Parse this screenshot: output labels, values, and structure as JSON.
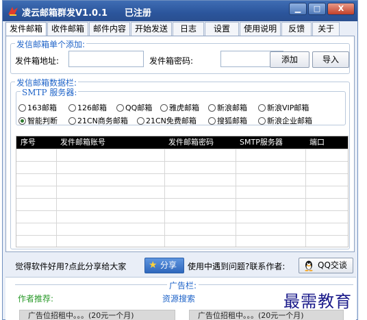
{
  "window": {
    "title": "凌云邮箱群发V1.0.1",
    "status": "已注册",
    "controls": {
      "minimize": "▁",
      "maximize": "□",
      "close": "X"
    }
  },
  "tabs": [
    {
      "label": "发件邮箱",
      "active": true
    },
    {
      "label": "收件邮箱",
      "active": false
    },
    {
      "label": "邮件内容",
      "active": false
    },
    {
      "label": "开始发送",
      "active": false
    },
    {
      "label": "日志",
      "active": false
    },
    {
      "label": "设置",
      "active": false
    },
    {
      "label": "使用说明",
      "active": false
    },
    {
      "label": "反馈",
      "active": false
    },
    {
      "label": "关于",
      "active": false
    }
  ],
  "add_section": {
    "legend": "发信邮箱单个添加:",
    "address_label": "发件箱地址:",
    "address_value": "",
    "password_label": "发件箱密码:",
    "password_value": "",
    "add_button": "添加",
    "import_button": "导入"
  },
  "data_section": {
    "legend": "发信邮箱数据栏:",
    "smtp_legend": "SMTP 服务器:",
    "smtp_options": [
      {
        "label": "163邮箱",
        "selected": false
      },
      {
        "label": "126邮箱",
        "selected": false
      },
      {
        "label": "QQ邮箱",
        "selected": false
      },
      {
        "label": "雅虎邮箱",
        "selected": false
      },
      {
        "label": "新浪邮箱",
        "selected": false
      },
      {
        "label": "新浪VIP邮箱",
        "selected": false
      },
      {
        "label": "智能判断",
        "selected": true
      },
      {
        "label": "21CN商务邮箱",
        "selected": false
      },
      {
        "label": "21CN免费邮箱",
        "selected": false
      },
      {
        "label": "搜狐邮箱",
        "selected": false
      },
      {
        "label": "新浪企业邮箱",
        "selected": false
      }
    ],
    "table": {
      "columns": [
        "序号",
        "发件邮箱账号",
        "发件邮箱密码",
        "SMTP服务器",
        "端口"
      ],
      "rows": []
    }
  },
  "share_row": {
    "prompt": "觉得软件好用?点此分享给大家",
    "share_button": "分享",
    "contact_prompt": "使用中遇到问题?联系作者:",
    "qq_button": "QQ交谈"
  },
  "ad_panel": {
    "title": "广告栏:",
    "author_recommend": "作者推荐:",
    "resource_search": "资源搜索",
    "slots": [
      "广告位招租中。。。(20元一个月)",
      "广告位招租中。。。(20元一个月)"
    ]
  },
  "watermark": "最需教育",
  "colors": {
    "accent_blue": "#1e63c8",
    "titlebar": "#2b559c",
    "recommend_green": "#2a9a2a"
  }
}
